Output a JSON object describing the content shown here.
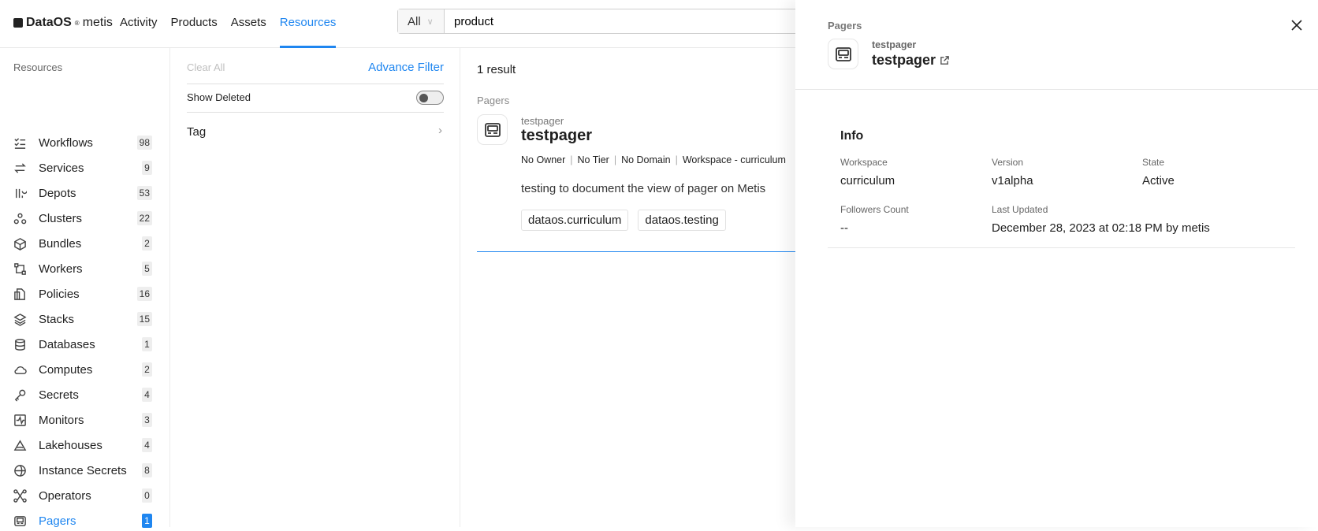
{
  "header": {
    "logo_brand": "DataOS",
    "logo_reg": "®",
    "logo_product": "metis",
    "nav": [
      "Activity",
      "Products",
      "Assets",
      "Resources"
    ],
    "active_nav": "Resources",
    "search": {
      "scope": "All",
      "value": "product"
    }
  },
  "sidebar": {
    "title": "Resources",
    "items": [
      {
        "label": "Workflows",
        "count": "98",
        "icon": "workflow-icon"
      },
      {
        "label": "Services",
        "count": "9",
        "icon": "services-icon"
      },
      {
        "label": "Depots",
        "count": "53",
        "icon": "depot-icon"
      },
      {
        "label": "Clusters",
        "count": "22",
        "icon": "cluster-icon"
      },
      {
        "label": "Bundles",
        "count": "2",
        "icon": "bundle-icon"
      },
      {
        "label": "Workers",
        "count": "5",
        "icon": "worker-icon"
      },
      {
        "label": "Policies",
        "count": "16",
        "icon": "policy-icon"
      },
      {
        "label": "Stacks",
        "count": "15",
        "icon": "stack-icon"
      },
      {
        "label": "Databases",
        "count": "1",
        "icon": "database-icon"
      },
      {
        "label": "Computes",
        "count": "2",
        "icon": "cloud-icon"
      },
      {
        "label": "Secrets",
        "count": "4",
        "icon": "key-icon"
      },
      {
        "label": "Monitors",
        "count": "3",
        "icon": "monitor-icon"
      },
      {
        "label": "Lakehouses",
        "count": "4",
        "icon": "lakehouse-icon"
      },
      {
        "label": "Instance Secrets",
        "count": "8",
        "icon": "globe-icon"
      },
      {
        "label": "Operators",
        "count": "0",
        "icon": "operator-icon"
      },
      {
        "label": "Pagers",
        "count": "1",
        "icon": "pager-icon",
        "active": true
      }
    ]
  },
  "filters": {
    "clear_all": "Clear All",
    "advance_filter": "Advance Filter",
    "show_deleted": "Show Deleted",
    "show_deleted_on": false,
    "tag": "Tag"
  },
  "results": {
    "count": "1 result",
    "group": "Pagers",
    "item": {
      "subtitle": "testpager",
      "name": "testpager",
      "meta": [
        "No Owner",
        "No Tier",
        "No Domain",
        "Workspace -  curriculum"
      ],
      "description": "testing to document the view of pager on Metis",
      "tags": [
        "dataos.curriculum",
        "dataos.testing"
      ]
    }
  },
  "drawer": {
    "group": "Pagers",
    "subtitle": "testpager",
    "name": "testpager",
    "info_title": "Info",
    "fields": {
      "workspace": {
        "label": "Workspace",
        "value": "curriculum"
      },
      "version": {
        "label": "Version",
        "value": "v1alpha"
      },
      "state": {
        "label": "State",
        "value": "Active"
      },
      "followers": {
        "label": "Followers Count",
        "value": "--"
      },
      "updated": {
        "label": "Last Updated",
        "value": "December 28, 2023 at 02:18 PM by metis"
      }
    }
  },
  "colors": {
    "accent": "#1f86f0"
  }
}
